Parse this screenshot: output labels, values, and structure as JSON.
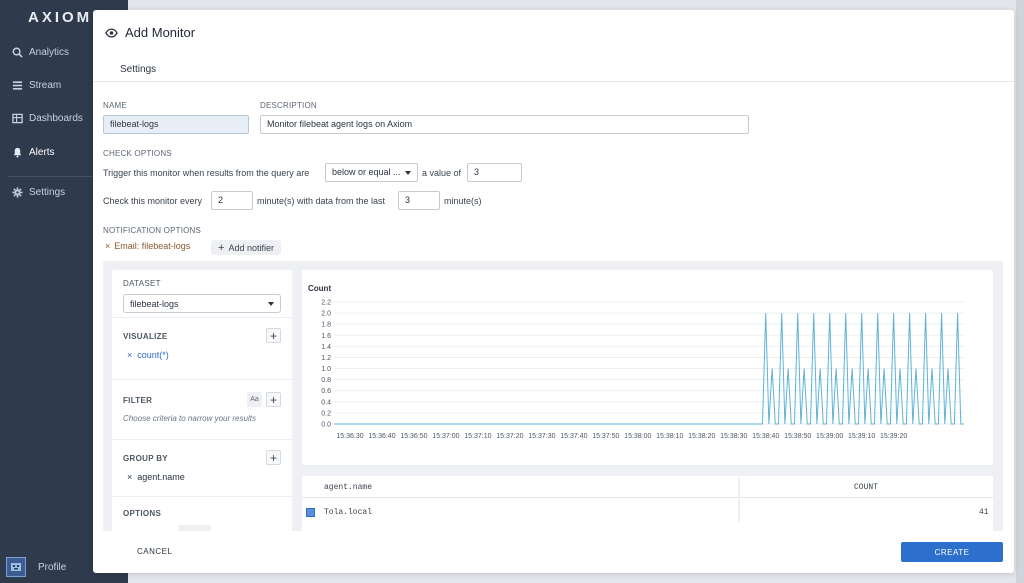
{
  "sidebar": {
    "logo": "AXIOM",
    "items": [
      {
        "label": "Analytics",
        "icon": "search-icon"
      },
      {
        "label": "Stream",
        "icon": "stream-icon"
      },
      {
        "label": "Dashboards",
        "icon": "dashboard-icon"
      },
      {
        "label": "Alerts",
        "icon": "bell-icon"
      },
      {
        "label": "Settings",
        "icon": "gear-icon"
      }
    ],
    "active": "Alerts",
    "profile_label": "Profile"
  },
  "modal": {
    "title": "Add Monitor",
    "tab": "Settings",
    "name_label": "NAME",
    "name_value": "filebeat-logs",
    "description_label": "DESCRIPTION",
    "description_value": "Monitor filebeat agent logs on Axiom",
    "check_options_label": "CHECK OPTIONS",
    "trigger_prefix": "Trigger this monitor when results from the query are",
    "trigger_operator": "below or equal ...",
    "trigger_mid": "a value of",
    "trigger_value": "3",
    "check_prefix": "Check this monitor every",
    "check_every": "2",
    "check_mid": "minute(s) with data from the last",
    "check_last": "3",
    "check_suffix": "minute(s)",
    "notification_label": "NOTIFICATION OPTIONS",
    "notifier_chip": "Email: filebeat-logs",
    "add_notifier": "Add notifier",
    "cancel": "CANCEL",
    "create": "CREATE"
  },
  "query": {
    "dataset_label": "DATASET",
    "dataset_value": "filebeat-logs",
    "visualize_label": "VISUALIZE",
    "visualize_item": "count(*)",
    "filter_label": "FILTER",
    "filter_case_toggle": "Aa",
    "filter_hint": "Choose criteria to narrow your results",
    "groupby_label": "GROUP BY",
    "groupby_item": "agent.name",
    "options_label": "OPTIONS"
  },
  "results": {
    "col1": "agent.name",
    "col2": "COUNT",
    "rows": [
      {
        "name": "Tola.local",
        "count": "41"
      }
    ]
  },
  "colors": {
    "accent": "#2c6fcc",
    "line": "#5fb3d8",
    "sidebar": "#2f3a4c"
  },
  "chart_data": {
    "type": "line",
    "ylabel": "Count",
    "ylim": [
      0,
      2.2
    ],
    "yticks": [
      "0.0",
      "0.2",
      "0.4",
      "0.6",
      "0.8",
      "1.0",
      "1.2",
      "1.4",
      "1.6",
      "1.8",
      "2.0",
      "2.2"
    ],
    "xticks": [
      "15:36:30",
      "15:36:40",
      "15:36:50",
      "15:37:00",
      "15:37:10",
      "15:37:20",
      "15:37:30",
      "15:37:40",
      "15:37:50",
      "15:38:00",
      "15:38:10",
      "15:38:20",
      "15:38:30",
      "15:38:40",
      "15:38:50",
      "15:39:00",
      "15:39:10",
      "15:39:20"
    ],
    "grid": true,
    "series": [
      {
        "x_start": "15:36:25",
        "step_seconds": 1,
        "values": [
          0,
          0,
          0,
          0,
          0,
          0,
          0,
          0,
          0,
          0,
          0,
          0,
          0,
          0,
          0,
          0,
          0,
          0,
          0,
          0,
          0,
          0,
          0,
          0,
          0,
          0,
          0,
          0,
          0,
          0,
          0,
          0,
          0,
          0,
          0,
          0,
          0,
          0,
          0,
          0,
          0,
          0,
          0,
          0,
          0,
          0,
          0,
          0,
          0,
          0,
          0,
          0,
          0,
          0,
          0,
          0,
          0,
          0,
          0,
          0,
          0,
          0,
          0,
          0,
          0,
          0,
          0,
          0,
          0,
          0,
          0,
          0,
          0,
          0,
          0,
          0,
          0,
          0,
          0,
          0,
          0,
          0,
          0,
          0,
          0,
          0,
          0,
          0,
          0,
          0,
          0,
          0,
          0,
          0,
          0,
          0,
          0,
          0,
          0,
          0,
          0,
          0,
          0,
          0,
          0,
          0,
          0,
          0,
          0,
          0,
          0,
          0,
          0,
          0,
          0,
          0,
          0,
          0,
          0,
          0,
          0,
          0,
          0,
          0,
          0,
          0,
          0,
          0,
          0,
          0,
          0,
          0,
          0,
          0,
          0,
          2,
          0,
          1,
          0,
          0,
          2,
          0,
          1,
          0,
          0,
          2,
          0,
          1,
          0,
          0,
          2,
          0,
          1,
          0,
          0,
          2,
          0,
          1,
          0,
          0,
          2,
          0,
          1,
          0,
          0,
          2,
          0,
          1,
          0,
          0,
          2,
          0,
          1,
          0,
          0,
          2,
          0,
          1,
          0,
          0,
          2,
          0,
          1,
          0,
          0,
          2,
          0,
          1,
          0,
          0,
          2,
          0,
          1,
          0,
          0,
          2,
          0,
          0
        ]
      }
    ]
  }
}
